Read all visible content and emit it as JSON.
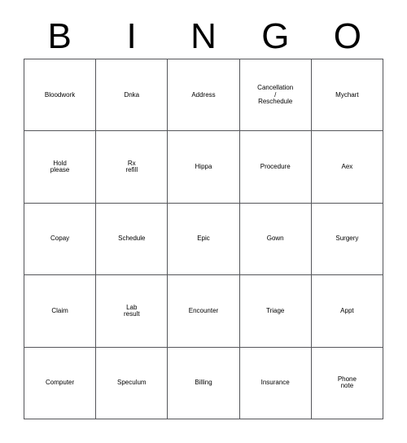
{
  "card": {
    "title": "BINGO",
    "background_color": "#ffffff",
    "text_color": "#000000",
    "border_color": "#55565a"
  },
  "header": {
    "letters": [
      "B",
      "I",
      "N",
      "G",
      "O"
    ]
  },
  "grid": {
    "columns": 5,
    "rows": 5,
    "cells": [
      {
        "label": "Bloodwork",
        "size": "xxs"
      },
      {
        "label": "Dnka",
        "size": "xxl"
      },
      {
        "label": "Address",
        "size": "m"
      },
      {
        "label": "Cancellation\n/\nReschedule",
        "size": "xxs"
      },
      {
        "label": "Mychart",
        "size": "m"
      },
      {
        "label": "Hold\nplease",
        "size": "l"
      },
      {
        "label": "Rx\nrefill",
        "size": "xl"
      },
      {
        "label": "Hippa",
        "size": "xl"
      },
      {
        "label": "Procedure",
        "size": "xs"
      },
      {
        "label": "Aex",
        "size": "xxl"
      },
      {
        "label": "Copay",
        "size": "l"
      },
      {
        "label": "Schedule",
        "size": "s"
      },
      {
        "label": "Epic",
        "size": "xxl"
      },
      {
        "label": "Gown",
        "size": "xl"
      },
      {
        "label": "Surgery",
        "size": "s"
      },
      {
        "label": "Claim",
        "size": "l"
      },
      {
        "label": "Lab\nresult",
        "size": "xl"
      },
      {
        "label": "Encounter",
        "size": "xs"
      },
      {
        "label": "Triage",
        "size": "l"
      },
      {
        "label": "Appt",
        "size": "xxl"
      },
      {
        "label": "Computer",
        "size": "xs"
      },
      {
        "label": "Speculum",
        "size": "xs"
      },
      {
        "label": "Billing",
        "size": "xl"
      },
      {
        "label": "Insurance",
        "size": "xs"
      },
      {
        "label": "Phone\nnote",
        "size": "l"
      }
    ]
  }
}
